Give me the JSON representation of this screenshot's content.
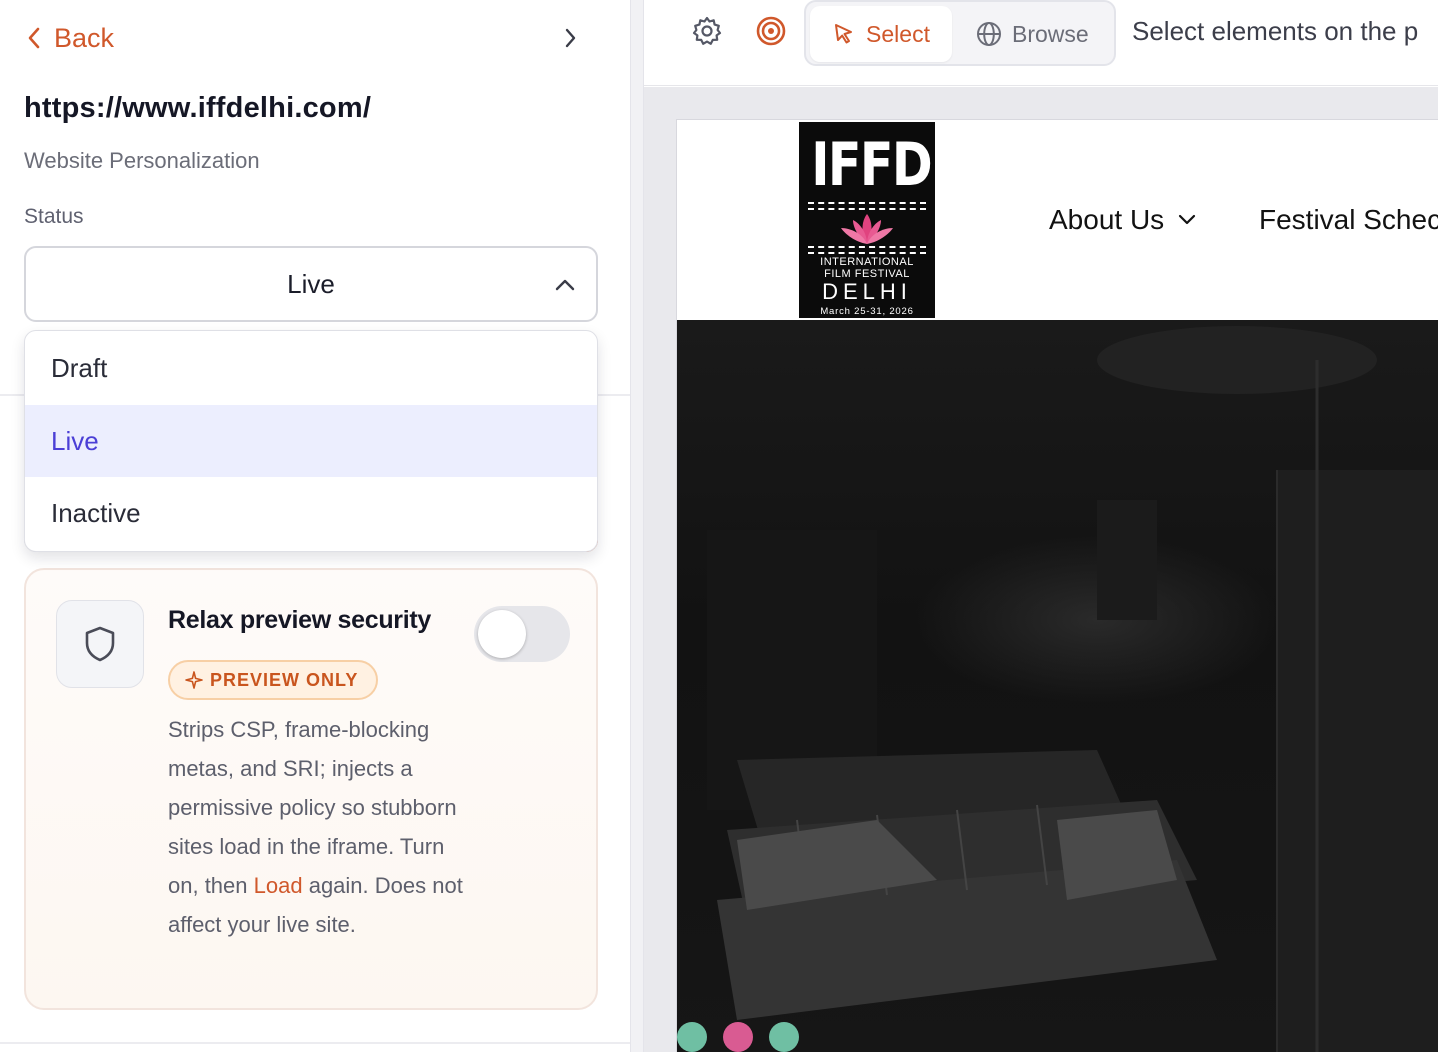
{
  "nav": {
    "back_label": "Back"
  },
  "page": {
    "url": "https://www.iffdelhi.com/",
    "subtitle": "Website Personalization"
  },
  "status": {
    "label": "Status",
    "selected": "Live",
    "options": [
      "Draft",
      "Live",
      "Inactive"
    ]
  },
  "security_card": {
    "title": "Relax preview security",
    "badge": "PREVIEW ONLY",
    "desc_before": "Strips CSP, frame-blocking metas, and SRI; injects a permissive policy so stubborn sites load in the iframe. Turn on, then ",
    "desc_link": "Load",
    "desc_after": " again. Does not affect your live site.",
    "toggle_on": false
  },
  "toolbar": {
    "select_label": "Select",
    "browse_label": "Browse",
    "hint": "Select elements on the p",
    "active_mode": "Select"
  },
  "site_preview": {
    "logo": {
      "letters": "IFFD",
      "line1": "INTERNATIONAL",
      "line2": "FILM FESTIVAL",
      "city": "DELHI",
      "dates": "March 25-31, 2026"
    },
    "nav_items": [
      "About Us",
      "Festival Schec"
    ],
    "carousel_dot_colors": [
      "#6fbfa3",
      "#d95b92",
      "#6fbfa3"
    ]
  },
  "colors": {
    "accent": "#d0582b",
    "selected_bg": "#eceefe",
    "selected_text": "#4b3fd6"
  }
}
